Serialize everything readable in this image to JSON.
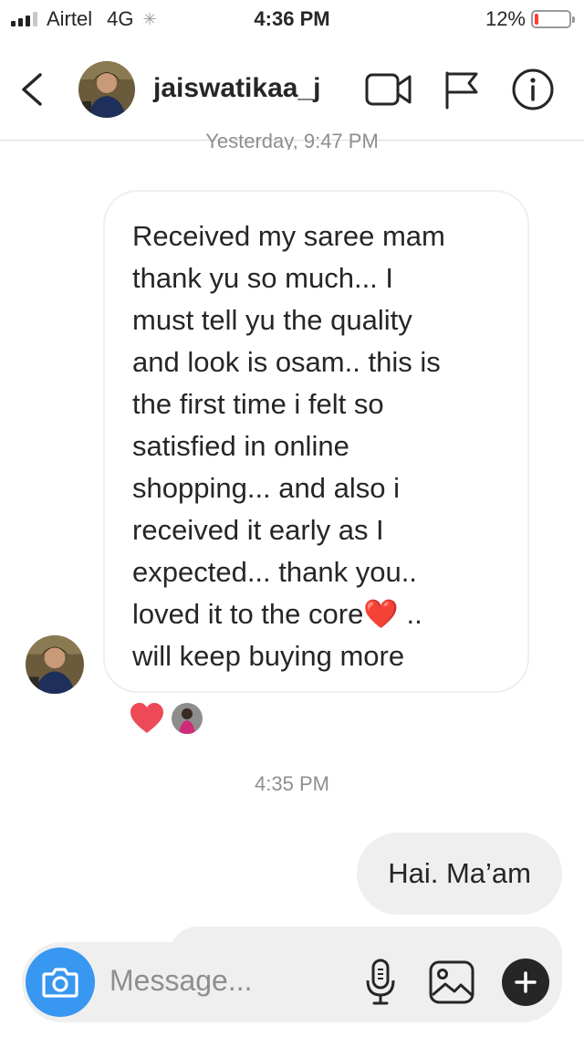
{
  "status_bar": {
    "carrier": "Airtel",
    "network": "4G",
    "time": "4:36 PM",
    "battery_text": "12%",
    "battery_level": 0.12,
    "battery_color": "#ff3b30"
  },
  "header": {
    "username": "jaiswatikaa_j",
    "icons": [
      "back-chevron-icon",
      "video-call-icon",
      "flag-icon",
      "info-icon"
    ]
  },
  "chat": {
    "timestamp_top": "Yesterday, 9:47 PM",
    "incoming_message_lines": [
      "Received my saree mam",
      "thank yu so much... I",
      "must tell yu the quality",
      "and look is osam.. this is",
      "the first time i felt so",
      "satisfied in online",
      "shopping... and also i",
      "received it early as I",
      "expected... thank you..",
      "loved it to the core❤️ ..",
      "will keep buying more"
    ],
    "reaction": "heart",
    "timestamp_mid": "4:35 PM",
    "outgoing_message": "Hai. Ma’am"
  },
  "composer": {
    "placeholder": "Message...",
    "icons": [
      "camera-icon",
      "microphone-icon",
      "gallery-icon",
      "plus-icon"
    ],
    "accent_color": "#3897f0"
  }
}
